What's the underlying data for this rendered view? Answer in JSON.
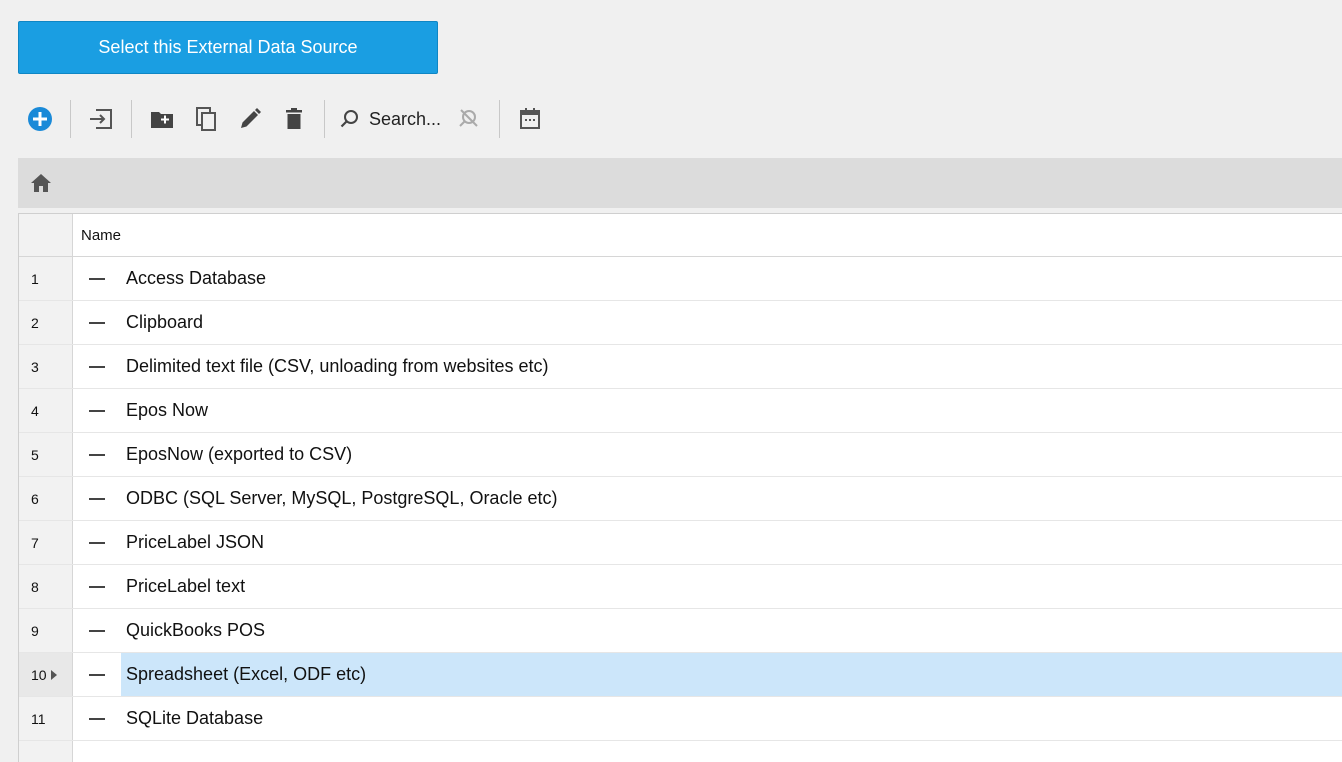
{
  "actions": {
    "select_label": "Select this External Data Source"
  },
  "toolbar": {
    "items": [
      {
        "name": "add-icon",
        "icon": "plus-circle-icon"
      },
      {
        "name": "import-icon",
        "icon": "import-icon"
      },
      {
        "name": "new-folder-icon",
        "icon": "folder-plus-icon"
      },
      {
        "name": "copy-icon",
        "icon": "copy-icon"
      },
      {
        "name": "edit-icon",
        "icon": "pencil-icon"
      },
      {
        "name": "delete-icon",
        "icon": "trash-icon"
      },
      {
        "name": "search-icon",
        "icon": "magnifier-icon"
      },
      {
        "name": "clear-search-icon",
        "icon": "search-off-icon"
      },
      {
        "name": "calendar-icon",
        "icon": "calendar-icon"
      }
    ],
    "search_label": "Search..."
  },
  "breadcrumb": {
    "home_icon": "home-icon"
  },
  "grid": {
    "column_header": "Name",
    "selected_row": 10,
    "rows": [
      {
        "num": "1",
        "name": "Access Database"
      },
      {
        "num": "2",
        "name": "Clipboard"
      },
      {
        "num": "3",
        "name": "Delimited text file (CSV, unloading from websites etc)"
      },
      {
        "num": "4",
        "name": "Epos Now"
      },
      {
        "num": "5",
        "name": "EposNow (exported to CSV)"
      },
      {
        "num": "6",
        "name": "ODBC (SQL Server, MySQL, PostgreSQL, Oracle etc)"
      },
      {
        "num": "7",
        "name": "PriceLabel JSON"
      },
      {
        "num": "8",
        "name": "PriceLabel text"
      },
      {
        "num": "9",
        "name": "QuickBooks POS"
      },
      {
        "num": "10",
        "name": "Spreadsheet (Excel, ODF etc)"
      },
      {
        "num": "11",
        "name": "SQLite Database"
      }
    ]
  },
  "colors": {
    "primary": "#1a9ee2",
    "selection": "#cce6fa",
    "add_icon": "#1a8ad8"
  }
}
